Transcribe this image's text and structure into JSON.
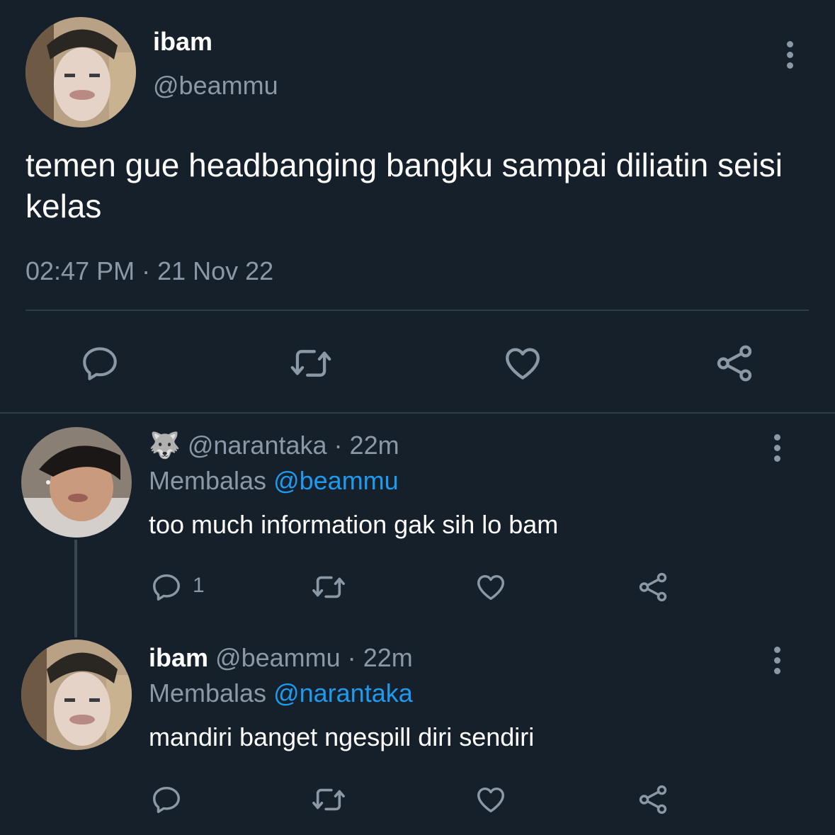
{
  "main_tweet": {
    "display_name": "ibam",
    "handle": "@beammu",
    "text": "temen gue headbanging bangku sampai diliatin seisi kelas",
    "timestamp": "02:47 PM · 21 Nov 22",
    "actions": [
      "reply-icon",
      "retweet-icon",
      "like-icon",
      "share-icon"
    ]
  },
  "replies": [
    {
      "emoji": "🐺",
      "handle": "@narantaka",
      "sep": "·",
      "time": "22m",
      "replying_prefix": "Membalas",
      "replying_to": "@beammu",
      "text": "too much information gak sih lo bam",
      "reply_count": "1"
    },
    {
      "display_name": "ibam",
      "handle": "@beammu",
      "sep": "·",
      "time": "22m",
      "replying_prefix": "Membalas",
      "replying_to": "@narantaka",
      "text": "mandiri banget ngespill diri sendiri",
      "reply_count": ""
    }
  ],
  "colors": {
    "background": "#16202b",
    "muted": "#8b98a5",
    "link": "#1d9bf0",
    "divider": "#2f3b47"
  }
}
